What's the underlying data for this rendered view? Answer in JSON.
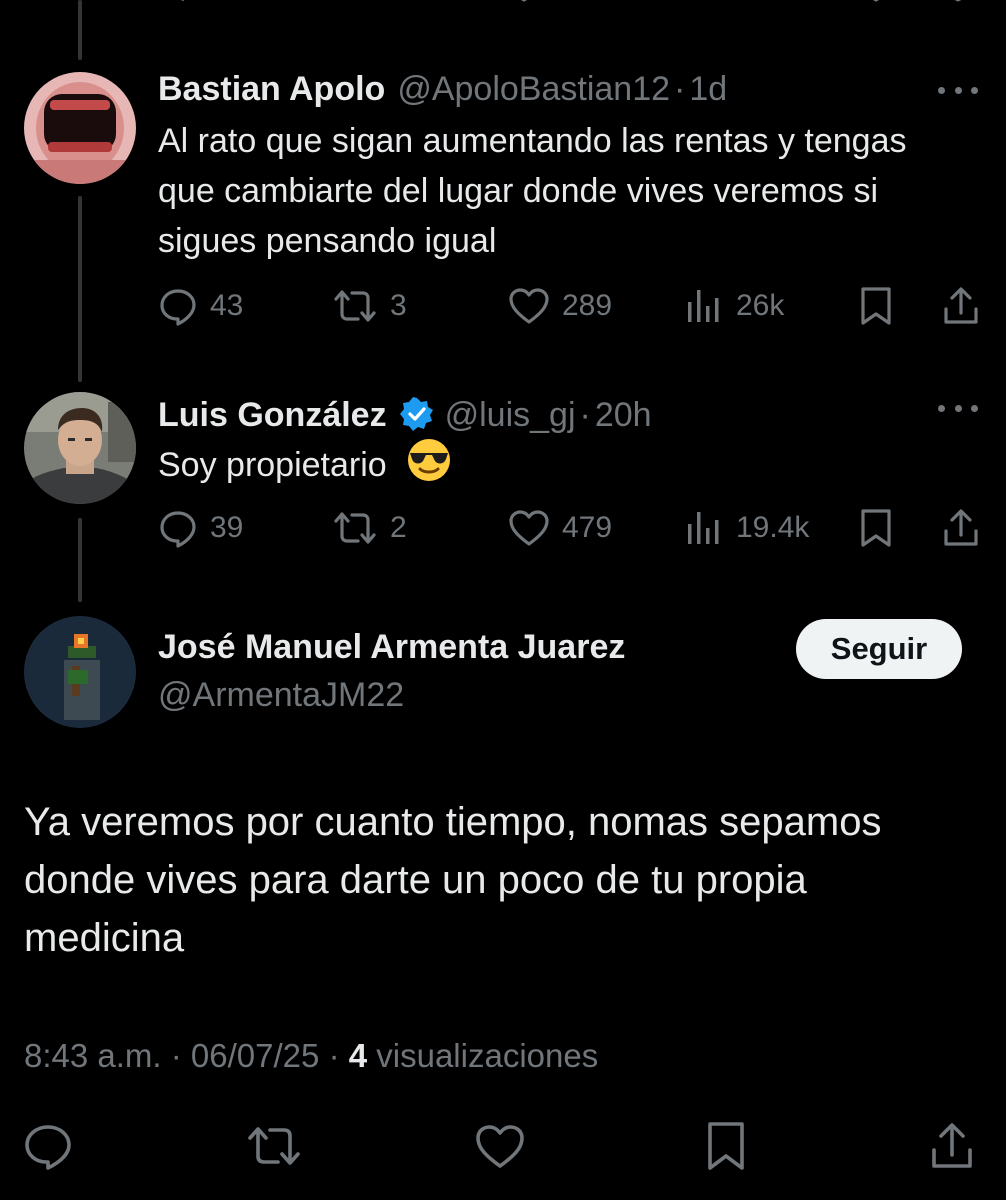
{
  "colors": {
    "background": "#000000",
    "text_primary": "#e7e9ea",
    "text_secondary": "#71767b",
    "verified_blue": "#1d9bf0",
    "follow_button_bg": "#eff3f4"
  },
  "replies": [
    {
      "name": "Bastian Apolo",
      "handle": "@ApoloBastian12",
      "separator": "·",
      "time": "1d",
      "text": "Al rato que sigan aumentando las rentas y tengas que cambiarte del lugar donde vives veremos si sigues pensando igual",
      "stats": {
        "replies": "43",
        "retweets": "3",
        "likes": "289",
        "views": "26k"
      }
    },
    {
      "name": "Luis González",
      "verified": true,
      "handle": "@luis_gj",
      "separator": "·",
      "time": "20h",
      "text": "Soy propietario",
      "emoji": "smiling-face-with-sunglasses",
      "stats": {
        "replies": "39",
        "retweets": "2",
        "likes": "479",
        "views": "19.4k"
      }
    }
  ],
  "main_tweet": {
    "name": "José Manuel Armenta Juarez",
    "handle": "@ArmentaJM22",
    "follow_label": "Seguir",
    "text": "Ya veremos por cuanto tiempo, nomas sepamos donde vives para darte un poco de tu propia medicina",
    "time": "8:43 a.m.",
    "separator": "·",
    "date": "06/07/25",
    "views_count": "4",
    "views_label": "visualizaciones"
  }
}
